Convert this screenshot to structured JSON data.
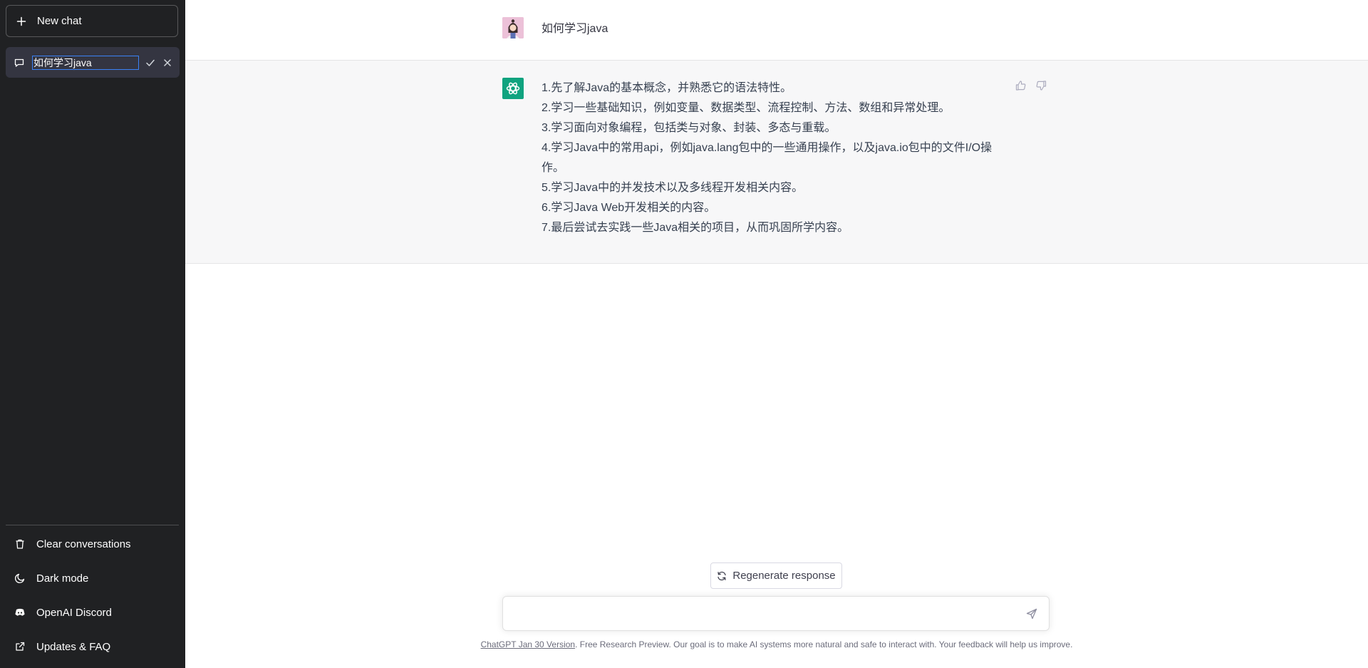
{
  "sidebar": {
    "new_chat_label": "New chat",
    "conversation": {
      "title_value": "如何学习java"
    },
    "links": {
      "clear": "Clear conversations",
      "dark_mode": "Dark mode",
      "discord": "OpenAI Discord",
      "updates": "Updates & FAQ"
    },
    "icons": [
      "plus-icon",
      "chat-bubble-icon",
      "check-icon",
      "close-icon",
      "trash-icon",
      "moon-icon",
      "discord-icon",
      "external-link-icon"
    ]
  },
  "messages": {
    "user": "如何学习java",
    "assistant": [
      "1.先了解Java的基本概念，并熟悉它的语法特性。",
      "2.学习一些基础知识，例如变量、数据类型、流程控制、方法、数组和异常处理。",
      "3.学习面向对象编程，包括类与对象、封装、多态与重载。",
      "4.学习Java中的常用api，例如java.lang包中的一些通用操作，以及java.io包中的文件I/O操作。",
      "5.学习Java中的并发技术以及多线程开发相关内容。",
      "6.学习Java Web开发相关的内容。",
      "7.最后尝试去实践一些Java相关的项目，从而巩固所学内容。"
    ]
  },
  "composer": {
    "regenerate_label": "Regenerate response",
    "input_value": ""
  },
  "footer": {
    "version_link": "ChatGPT Jan 30 Version",
    "text": ". Free Research Preview. Our goal is to make AI systems more natural and safe to interact with. Your feedback will help us improve."
  },
  "colors": {
    "sidebar_bg": "#202123",
    "selected_item_bg": "#343541",
    "assistant_row_bg": "#f7f7f8",
    "openai_green": "#10a37f",
    "input_focus_border": "#3b82f6"
  }
}
